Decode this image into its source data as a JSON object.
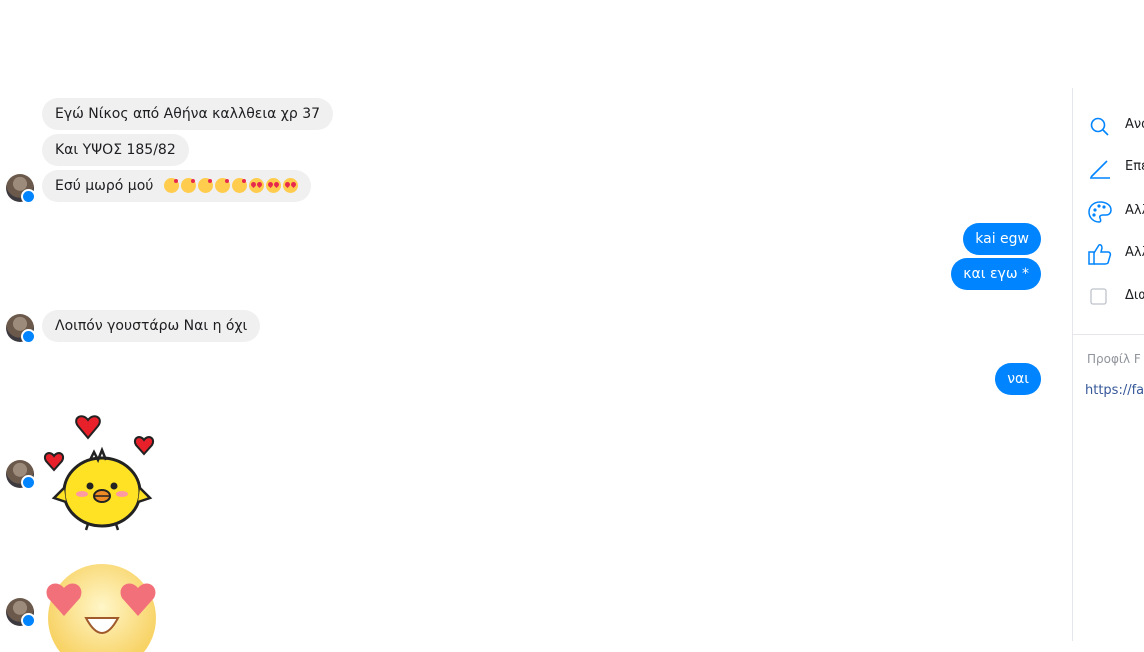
{
  "incoming": [
    "Εγώ Νίκος από Αθήνα καλλθεια χρ 37",
    "Και ΥΨΟΣ 185/82",
    "Εσύ μωρό μού",
    "Λοιπόν γουστάρω Ναι η όχι"
  ],
  "outgoing": [
    "kai egw",
    "και εγω *",
    "ναι"
  ],
  "emoji_row": [
    "kissing-face",
    "kissing-face",
    "kissing-face",
    "kissing-face",
    "kissing-face",
    "heart-eyes",
    "heart-eyes",
    "heart-eyes"
  ],
  "stickers": [
    "chick-with-hearts-sticker",
    "heart-eyes-face-sticker"
  ],
  "colors": {
    "outgoing_bubble": "#0084ff",
    "incoming_bubble": "#f1f0f0",
    "accent": "#0084ff"
  },
  "sidebar": {
    "items": [
      {
        "icon": "search-icon",
        "label": "Ανα"
      },
      {
        "icon": "pencil-icon",
        "label": "Επε"
      },
      {
        "icon": "palette-icon",
        "label": "Αλλ"
      },
      {
        "icon": "thumbs-up-icon",
        "label": "Αλλ"
      },
      {
        "icon": "checkbox",
        "label": "Δια"
      }
    ],
    "profile_label": "Προφίλ F",
    "profile_link": "https://fac"
  }
}
